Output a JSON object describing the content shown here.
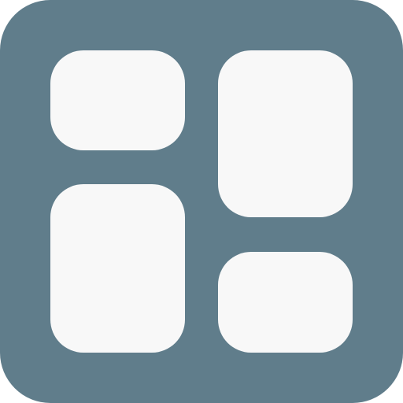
{
  "icon": {
    "name": "dashboard-layout-icon",
    "colors": {
      "frame": "#607d8b",
      "tile": "#f8f8f8",
      "page_background": "#ffffff"
    }
  }
}
